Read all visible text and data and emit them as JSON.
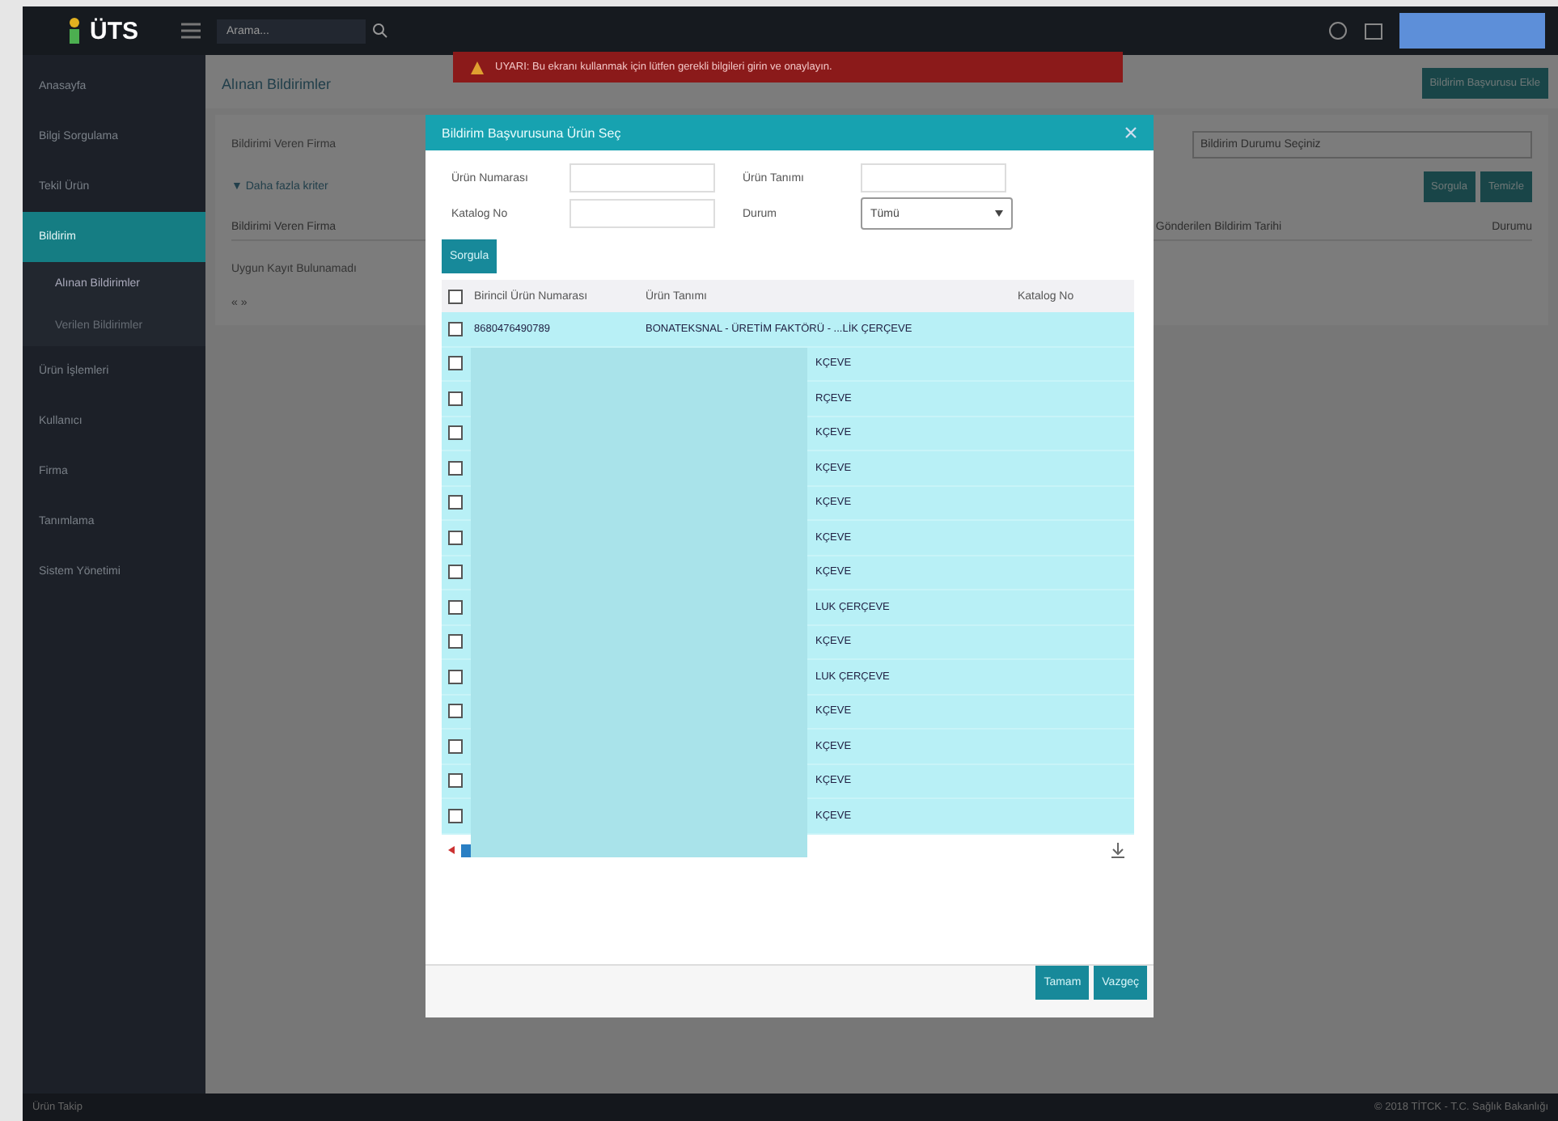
{
  "topbar": {
    "logo": "ÜTS",
    "search_placeholder": "Arama..."
  },
  "alert": {
    "text": "UYARI: Bu ekranı kullanmak için lütfen gerekli bilgileri girin ve onaylayın."
  },
  "sidebar": {
    "items": [
      {
        "label": "Anasayfa",
        "selected": false
      },
      {
        "label": "Bilgi Sorgulama",
        "selected": false
      },
      {
        "label": "Tekil Ürün",
        "selected": false
      },
      {
        "label": "Bildirim",
        "selected": true,
        "children": [
          {
            "label": "Alınan Bildirimler",
            "selected": true
          },
          {
            "label": "Verilen Bildirimler",
            "selected": false
          }
        ]
      },
      {
        "label": "Ürün İşlemleri",
        "selected": false
      },
      {
        "label": "Kullanıcı",
        "selected": false
      },
      {
        "label": "Firma",
        "selected": false
      },
      {
        "label": "Tanımlama",
        "selected": false
      },
      {
        "label": "Sistem Yönetimi",
        "selected": false
      }
    ]
  },
  "page": {
    "title": "Alınan Bildirimler",
    "add_button": "Bildirim Başvurusu Ekle",
    "filter_label": "Bildirimi Veren Firma",
    "more_link": "▼ Daha fazla kriter",
    "status_select": "Bildirim Durumu Seçiniz",
    "buttons": [
      "Sorgula",
      "Temizle"
    ],
    "columns": [
      "Bildirimi Veren Firma",
      "Gönderilen Bildirim Tarihi",
      "Durumu"
    ],
    "empty_text": "Uygun Kayıt Bulunamadı",
    "pager": "« »"
  },
  "modal": {
    "title": "Bildirim Başvurusuna Ürün Seç",
    "fields": [
      {
        "label": "Ürün Numarası",
        "kind": "input"
      },
      {
        "label": "Ürün Tanımı",
        "kind": "input"
      },
      {
        "label": "Katalog No",
        "kind": "input"
      },
      {
        "label": "Durum",
        "kind": "select",
        "value": "Tümü"
      }
    ],
    "search_button": "Sorgula",
    "select_all_checked": false,
    "columns": [
      "Birincil Ürün Numarası",
      "Ürün Tanımı",
      "Katalog No"
    ],
    "rows": [
      {
        "checked": false,
        "number": "8680476490789",
        "description": "BONATEKSNAL - ÜRETİM FAKTÖRÜ - ...LİK ÇERÇEVE"
      },
      {
        "checked": false,
        "description": "KÇEVE"
      },
      {
        "checked": false,
        "description": "RÇEVE"
      },
      {
        "checked": false,
        "description": "KÇEVE"
      },
      {
        "checked": false,
        "description": "KÇEVE"
      },
      {
        "checked": false,
        "description": "KÇEVE"
      },
      {
        "checked": false,
        "description": "KÇEVE"
      },
      {
        "checked": false,
        "description": "KÇEVE"
      },
      {
        "checked": false,
        "description": "LUK ÇERÇEVE"
      },
      {
        "checked": false,
        "description": "KÇEVE"
      },
      {
        "checked": false,
        "description": "LUK ÇERÇEVE"
      },
      {
        "checked": false,
        "description": "KÇEVE"
      },
      {
        "checked": false,
        "description": "KÇEVE"
      },
      {
        "checked": false,
        "description": "KÇEVE"
      },
      {
        "checked": false,
        "description": "KÇEVE"
      }
    ],
    "footer_buttons": [
      "Tamam",
      "Vazgeç"
    ]
  },
  "status_bar": {
    "left": "Ürün Takip",
    "right": "© 2018 TİTCK - T.C. Sağlık Bakanlığı"
  }
}
